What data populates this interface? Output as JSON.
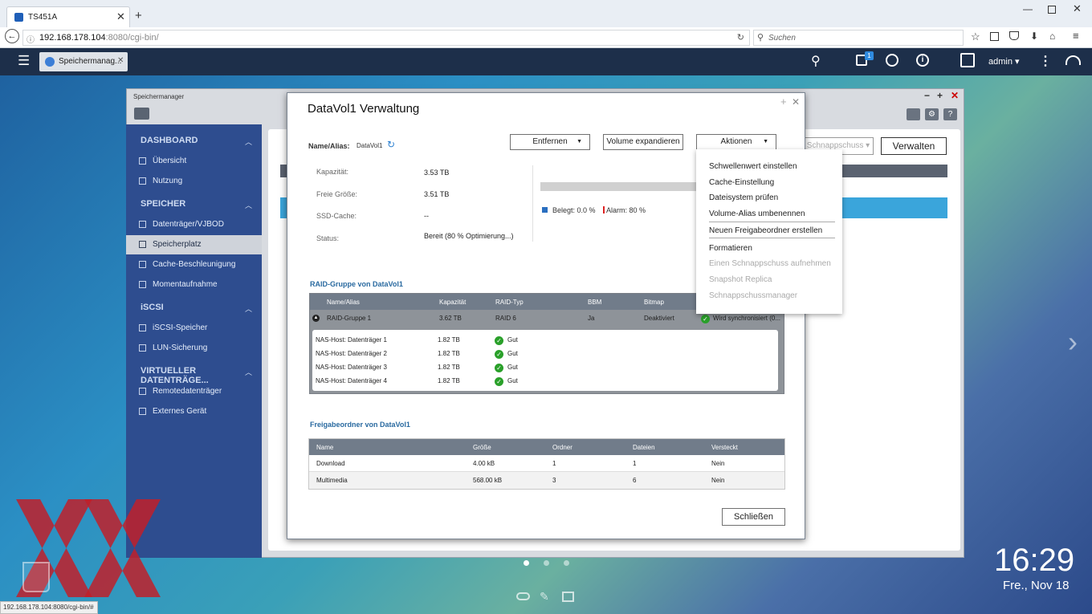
{
  "browser": {
    "tab_title": "TS451A",
    "url_host": "192.168.178.104",
    "url_rest": ":8080/cgi-bin/",
    "search_placeholder": "Suchen",
    "status_url": "192.168.178.104:8080/cgi-bin/#"
  },
  "taskbar": {
    "app_tab": "Speichermanag...",
    "user": "admin ▾",
    "notification_count": "1"
  },
  "window": {
    "title": "Speichermanager",
    "background_buttons": [
      "Schnappschuss ▾",
      "Verwalten"
    ]
  },
  "sidebar": {
    "sections": [
      {
        "title": "DASHBOARD",
        "items": [
          "Übersicht",
          "Nutzung"
        ]
      },
      {
        "title": "SPEICHER",
        "items": [
          "Datenträger/VJBOD",
          "Speicherplatz",
          "Cache-Beschleunigung",
          "Momentaufnahme"
        ]
      },
      {
        "title": "iSCSI",
        "items": [
          "iSCSI-Speicher",
          "LUN-Sicherung"
        ]
      },
      {
        "title": "VIRTUELLER DATENTRÄGE...",
        "items": [
          "Remotedatenträger",
          "Externes Gerät"
        ]
      }
    ],
    "active_item": "Speicherplatz"
  },
  "dialog": {
    "title": "DataVol1 Verwaltung",
    "name_alias_label": "Name/Alias:",
    "name_alias_value": "DataVol1",
    "buttons": {
      "remove": "Entfernen",
      "expand": "Volume expandieren",
      "actions": "Aktionen",
      "close": "Schließen"
    },
    "info": [
      {
        "label": "Kapazität:",
        "value": "3.53 TB"
      },
      {
        "label": "Freie Größe:",
        "value": "3.51 TB"
      },
      {
        "label": "SSD-Cache:",
        "value": "--"
      },
      {
        "label": "Status:",
        "value": "Bereit (80 % Optimierung...)"
      }
    ],
    "usage_legend": {
      "used_label": "Belegt:",
      "used_value": "0.0 %",
      "alarm_label": "Alarm:",
      "alarm_value": "80 %"
    },
    "raid_section_title": "RAID-Gruppe von DataVol1",
    "raid_headers": [
      "Name/Alias",
      "Kapazität",
      "RAID-Typ",
      "BBM",
      "Bitmap"
    ],
    "raid_group": {
      "name": "RAID-Gruppe 1",
      "capacity": "3.62 TB",
      "type": "RAID 6",
      "bbm": "Ja",
      "bitmap": "Deaktiviert",
      "status": "Wird synchronisiert (0..."
    },
    "disks": [
      {
        "name": "NAS-Host: Datenträger 1",
        "size": "1.82 TB",
        "status": "Gut"
      },
      {
        "name": "NAS-Host: Datenträger 2",
        "size": "1.82 TB",
        "status": "Gut"
      },
      {
        "name": "NAS-Host: Datenträger 3",
        "size": "1.82 TB",
        "status": "Gut"
      },
      {
        "name": "NAS-Host: Datenträger 4",
        "size": "1.82 TB",
        "status": "Gut"
      }
    ],
    "share_section_title": "Freigabeordner von DataVol1",
    "share_headers": [
      "Name",
      "Größe",
      "Ordner",
      "Dateien",
      "Versteckt"
    ],
    "shares": [
      {
        "name": "Download",
        "size": "4.00 kB",
        "folders": "1",
        "files": "1",
        "hidden": "Nein"
      },
      {
        "name": "Multimedia",
        "size": "568.00 kB",
        "folders": "3",
        "files": "6",
        "hidden": "Nein"
      }
    ]
  },
  "actions_menu": {
    "items": [
      {
        "label": "Schwellenwert einstellen",
        "enabled": true
      },
      {
        "label": "Cache-Einstellung",
        "enabled": true
      },
      {
        "label": "Dateisystem prüfen",
        "enabled": true
      },
      {
        "label": "Volume-Alias umbenennen",
        "enabled": true
      },
      {
        "label": "Neuen Freigabeordner erstellen",
        "enabled": true
      },
      {
        "label": "Formatieren",
        "enabled": true
      },
      {
        "label": "Einen Schnappschuss aufnehmen",
        "enabled": false
      },
      {
        "label": "Snapshot Replica",
        "enabled": false
      },
      {
        "label": "Schnappschussmanager",
        "enabled": false
      }
    ]
  },
  "clock": {
    "time": "16:29",
    "date": "Fre., Nov 18"
  },
  "colors": {
    "accent": "#2e4d8f",
    "table_header": "#717c8a",
    "ok": "#2aa02a",
    "link": "#2a6aa0"
  }
}
